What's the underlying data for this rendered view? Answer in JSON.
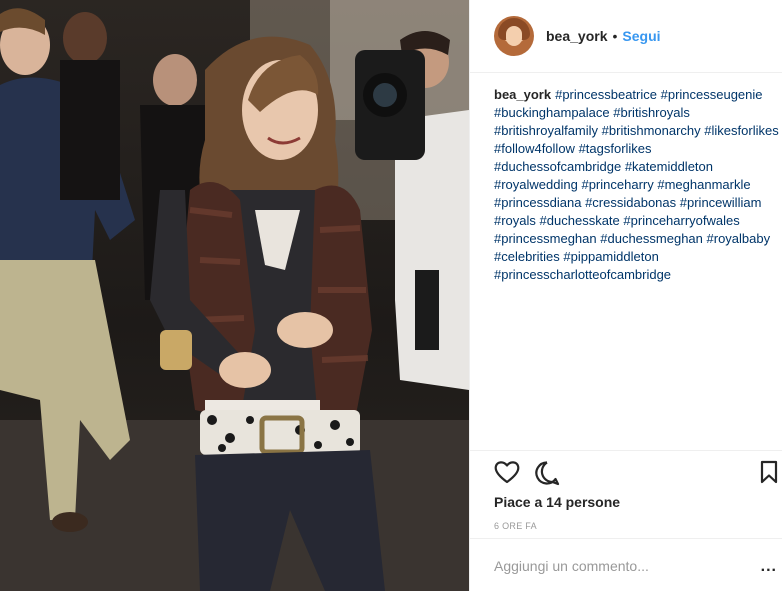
{
  "post": {
    "username": "bea_york",
    "separator": "•",
    "follow_label": "Segui",
    "caption_user": "bea_york",
    "hashtags": [
      "#princessbeatrice",
      "#princesseugenie",
      "#buckinghampalace",
      "#britishroyals",
      "#britishroyalfamily",
      "#britishmonarchy",
      "#likesforlikes",
      "#follow4follow",
      "#tagsforlikes",
      "#duchessofcambridge",
      "#katemiddleton",
      "#royalwedding",
      "#princeharry",
      "#meghanmarkle",
      "#princessdiana",
      "#cressidabonas",
      "#princewilliam",
      "#royals",
      "#duchesskate",
      "#princeharryofwales",
      "#princessmeghan",
      "#duchessmeghan",
      "#royalbaby",
      "#celebrities",
      "#pippamiddleton",
      "#princesscharlotteofcambridge"
    ],
    "likes_text": "Piace a 14 persone",
    "time_text": "6 ORE FA",
    "comment_placeholder": "Aggiungi un commento...",
    "more_label": "..."
  },
  "icons": {
    "like": "heart-icon",
    "comment": "comment-icon",
    "save": "bookmark-icon"
  },
  "colors": {
    "link_blue": "#3897f0",
    "hashtag_blue": "#003569",
    "muted_gray": "#999999",
    "text_dark": "#262626"
  }
}
